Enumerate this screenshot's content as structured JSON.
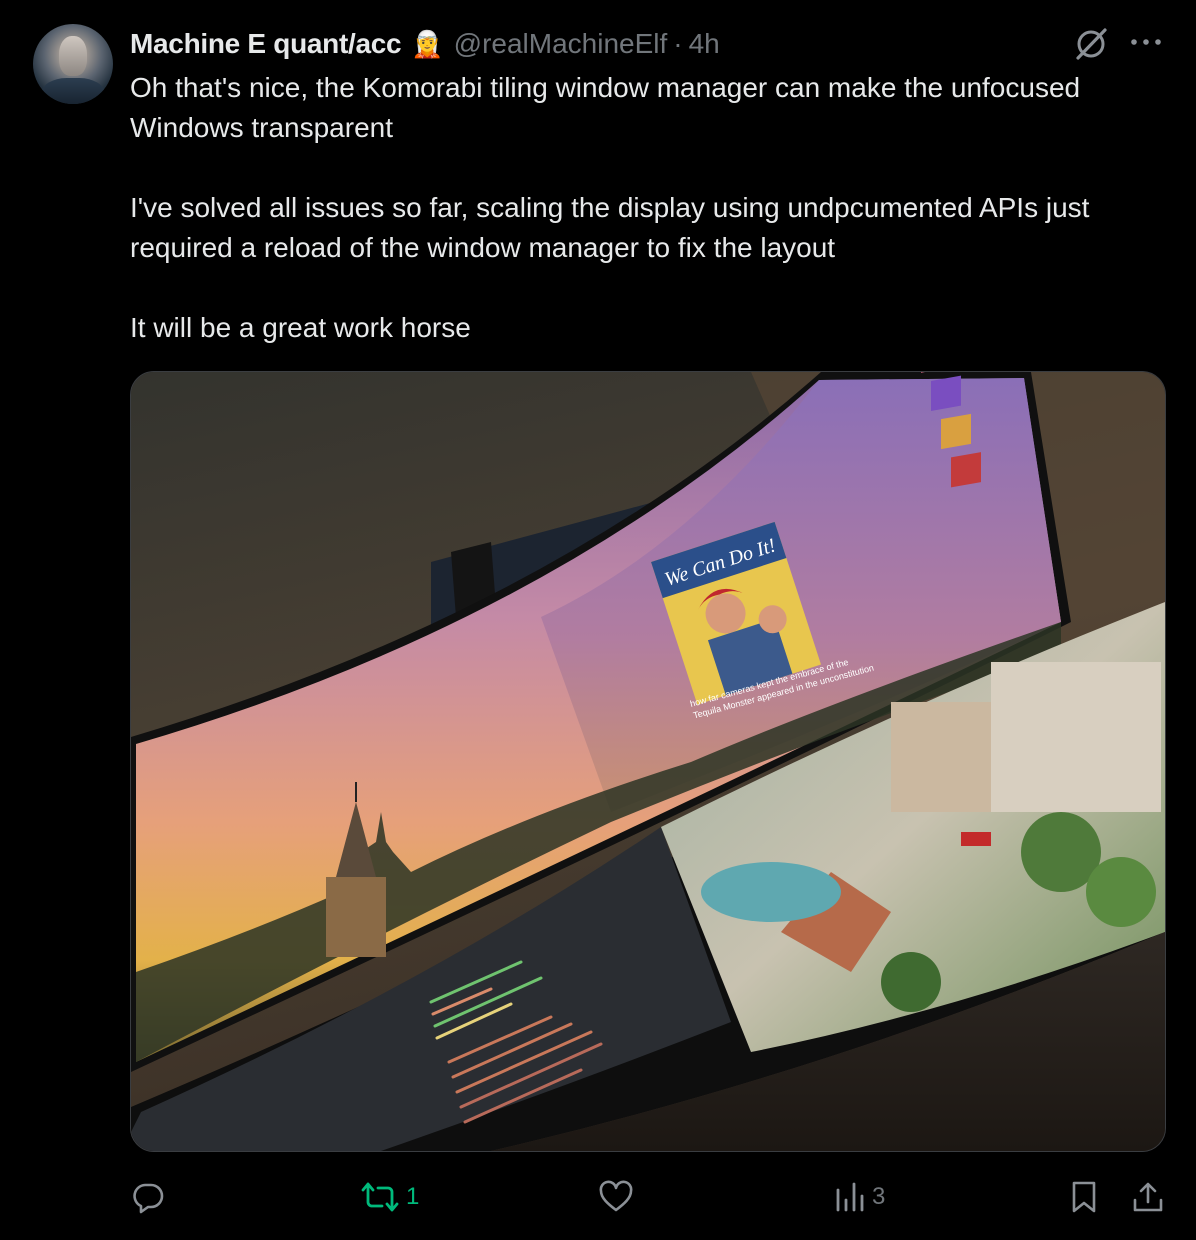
{
  "author": {
    "name": "Machine E quant/acc",
    "emoji": "🧝",
    "handle": "@realMachineElf",
    "separator": "·",
    "time": "4h"
  },
  "post": {
    "paragraphs": [
      "Oh that's nice, the Komorabi tiling window manager can make the unfocused Windows transparent",
      "I've solved all issues so far, scaling the display using undpcumented APIs just required a reload of the window manager to fix the layout",
      "It will be a great work horse"
    ],
    "image": {
      "poster_text": "We Can Do It!",
      "subtitle_line_1": "how far cameras kept the embrace of the",
      "subtitle_line_2": "Tequila Monster appeared in the unconstitution"
    }
  },
  "actions": {
    "reply": {
      "icon": "reply-icon",
      "count": ""
    },
    "repost": {
      "icon": "repost-icon",
      "count": "1",
      "color": "#00ba7c"
    },
    "like": {
      "icon": "heart-icon",
      "count": ""
    },
    "views": {
      "icon": "views-icon",
      "count": "3"
    },
    "bookmark": {
      "icon": "bookmark-icon"
    },
    "share": {
      "icon": "share-icon"
    }
  },
  "colors": {
    "background": "#000000",
    "text": "#e7e9ea",
    "muted": "#71767b",
    "repost_green": "#00ba7c"
  }
}
